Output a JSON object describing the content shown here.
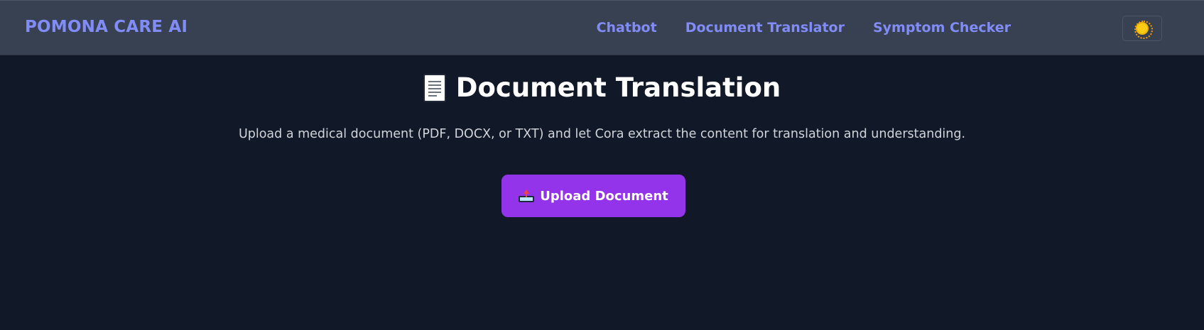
{
  "header": {
    "brand": "POMONA CARE AI",
    "nav": [
      {
        "label": "Chatbot"
      },
      {
        "label": "Document Translator"
      },
      {
        "label": "Symptom Checker"
      }
    ],
    "theme_toggle_icon": "sun-icon"
  },
  "main": {
    "title_icon": "document-icon",
    "title": "Document Translation",
    "description": "Upload a medical document (PDF, DOCX, or TXT) and let Cora extract the content for translation and understanding.",
    "upload_button": {
      "icon": "outbox-tray-icon",
      "label": "Upload Document"
    }
  },
  "colors": {
    "background": "#111827",
    "navbar": "#374151",
    "accent": "#818cf8",
    "button": "#9333ea"
  }
}
